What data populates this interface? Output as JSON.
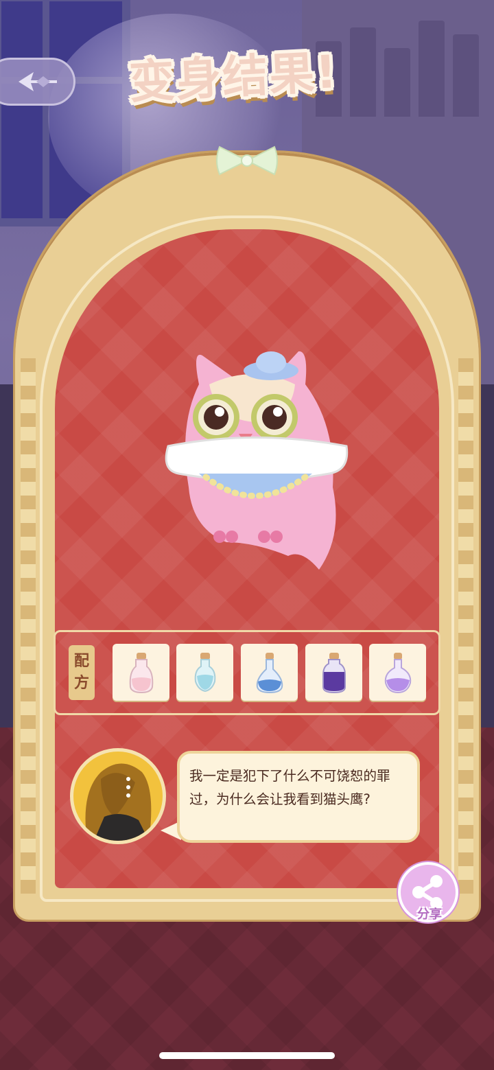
{
  "screen": {
    "title": "变身结果!",
    "recipe_label_line1": "配",
    "recipe_label_line2": "方",
    "dialogue_line1": "我一定是犯下了什么不可饶恕的罪",
    "dialogue_line2": "过，为什么会让我看到猫头鹰?",
    "share_label": "分享"
  },
  "recipe": {
    "potions": [
      {
        "icon": "pink-potion-icon",
        "color": "#f6c4cf"
      },
      {
        "icon": "teal-potion-icon",
        "color": "#9fd8e6"
      },
      {
        "icon": "blue-potion-icon",
        "color": "#5b8fd6"
      },
      {
        "icon": "purple-potion-icon",
        "color": "#5b3aa0"
      },
      {
        "icon": "lavender-potion-icon",
        "color": "#b58ee8"
      }
    ]
  },
  "colors": {
    "panel_red": "#c94a45",
    "frame_gold": "#e9cf95",
    "share_pink": "#e9b6ec"
  }
}
